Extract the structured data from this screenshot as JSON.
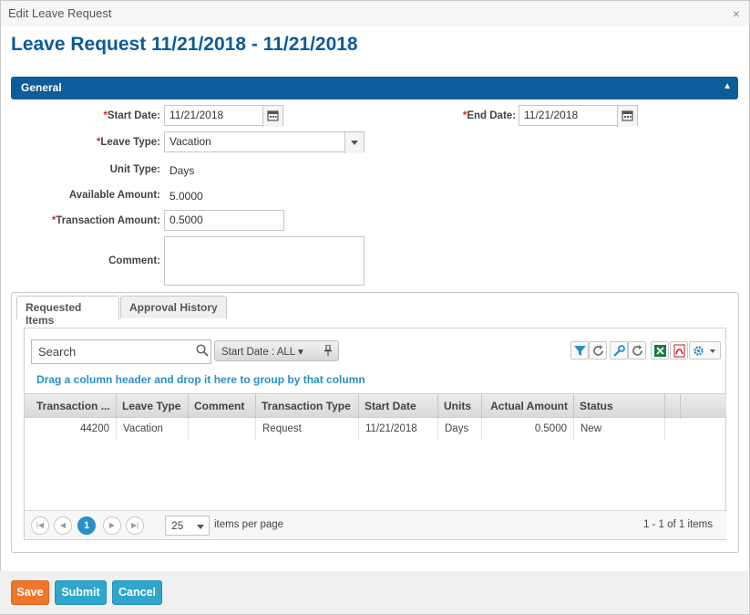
{
  "window": {
    "title": "Edit Leave Request",
    "close_glyph": "×"
  },
  "page": {
    "heading": "Leave Request 11/21/2018 - 11/21/2018"
  },
  "section": {
    "title": "General",
    "collapse_glyph": "▲"
  },
  "form": {
    "required_mark": "*",
    "start_date": {
      "label": "Start Date:",
      "value": "11/21/2018"
    },
    "end_date": {
      "label": "End Date:",
      "value": "11/21/2018"
    },
    "leave_type": {
      "label": "Leave Type:",
      "value": "Vacation"
    },
    "unit_type": {
      "label": "Unit Type:",
      "value": "Days"
    },
    "available_amount": {
      "label": "Available Amount:",
      "value": "5.0000"
    },
    "transaction_amount": {
      "label": "Transaction Amount:",
      "value": "0.5000"
    },
    "comment": {
      "label": "Comment:",
      "value": ""
    }
  },
  "tabs": [
    "Requested Items",
    "Approval History"
  ],
  "grid": {
    "search_placeholder": "Search",
    "filter_chip": "Start Date : ALL ▾",
    "group_hint": "Drag a column header and drop it here to group by that column",
    "columns": [
      "Transaction ...",
      "Leave Type",
      "Comment",
      "Transaction Type",
      "Start Date",
      "Units",
      "Actual Amount",
      "Status"
    ],
    "rows": [
      [
        "44200",
        "Vacation",
        "",
        "Request",
        "11/21/2018",
        "Days",
        "0.5000",
        "New"
      ]
    ],
    "toolbar_icons": [
      "filter-icon",
      "refresh-icon",
      "wrench-icon",
      "reset-icon",
      "excel-icon",
      "pdf-icon",
      "settings-icon"
    ],
    "pager": {
      "current_page": "1",
      "page_size": "25",
      "items_per_page_label": "items per page",
      "info": "1 - 1 of 1 items"
    }
  },
  "buttons": {
    "save": "Save",
    "submit": "Submit",
    "cancel": "Cancel"
  },
  "colors": {
    "accent": "#0e5c99",
    "heading": "#0b5a9a",
    "save": "#f0762a",
    "action": "#2fa6cc",
    "link": "#2a8fc8",
    "required": "#d9262a"
  }
}
